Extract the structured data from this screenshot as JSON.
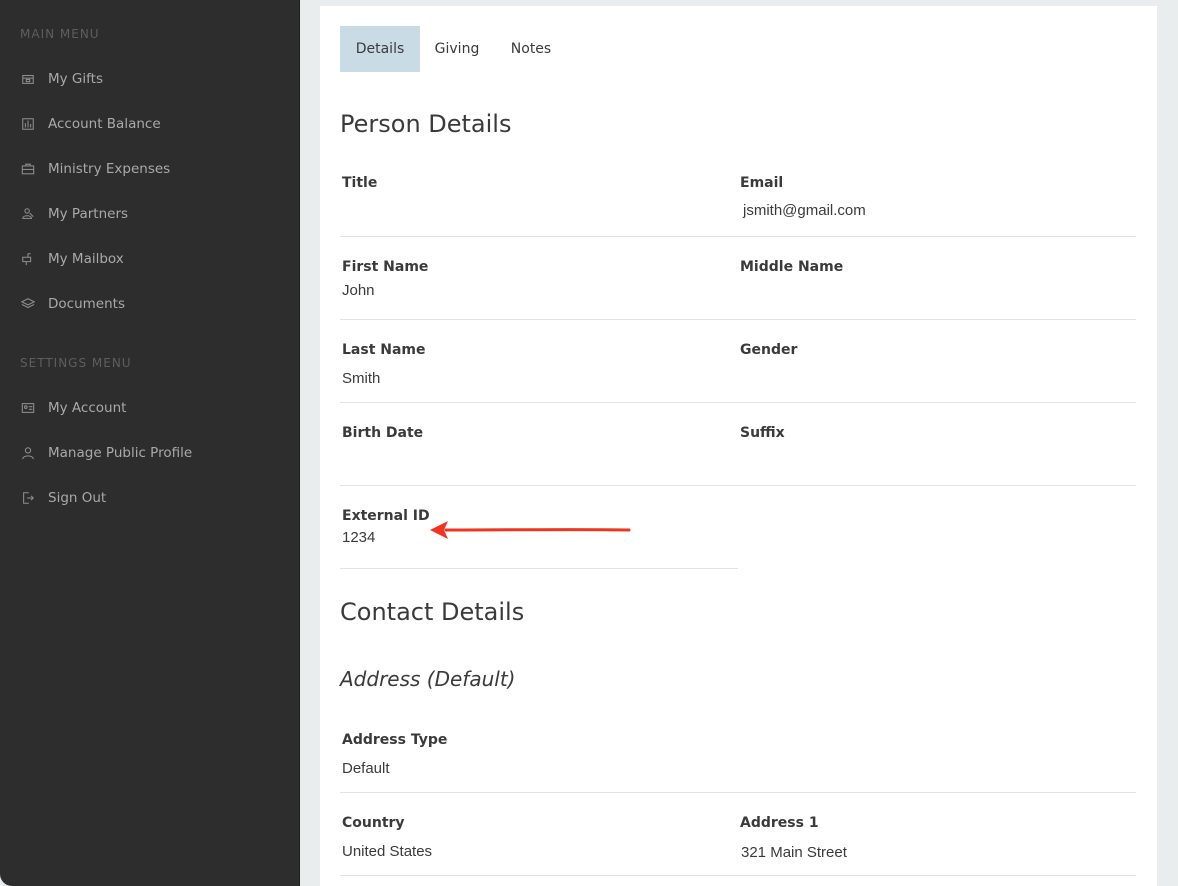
{
  "sidebar": {
    "main_menu_heading": "MAIN MENU",
    "main_items": [
      {
        "label": "My Gifts",
        "icon": "gift-icon"
      },
      {
        "label": "Account Balance",
        "icon": "bar-chart-icon"
      },
      {
        "label": "Ministry Expenses",
        "icon": "briefcase-icon"
      },
      {
        "label": "My Partners",
        "icon": "partners-icon"
      },
      {
        "label": "My Mailbox",
        "icon": "mailbox-icon"
      },
      {
        "label": "Documents",
        "icon": "layers-icon"
      }
    ],
    "settings_menu_heading": "SETTINGS MENU",
    "settings_items": [
      {
        "label": "My Account",
        "icon": "id-card-icon"
      },
      {
        "label": "Manage Public Profile",
        "icon": "user-icon"
      },
      {
        "label": "Sign Out",
        "icon": "sign-out-icon"
      }
    ]
  },
  "tabs": [
    {
      "label": "Details",
      "active": true
    },
    {
      "label": "Giving",
      "active": false
    },
    {
      "label": "Notes",
      "active": false
    }
  ],
  "person_details": {
    "title": "Person Details",
    "fields": {
      "title": {
        "label": "Title",
        "value": ""
      },
      "email": {
        "label": "Email",
        "value": "jsmith@gmail.com"
      },
      "first_name": {
        "label": "First Name",
        "value": "John"
      },
      "middle_name": {
        "label": "Middle Name",
        "value": ""
      },
      "last_name": {
        "label": "Last Name",
        "value": "Smith"
      },
      "gender": {
        "label": "Gender",
        "value": ""
      },
      "birth_date": {
        "label": "Birth Date",
        "value": ""
      },
      "suffix": {
        "label": "Suffix",
        "value": ""
      },
      "external_id": {
        "label": "External ID",
        "value": "1234"
      }
    }
  },
  "contact_details": {
    "title": "Contact Details",
    "address_heading": "Address (Default)",
    "fields": {
      "address_type": {
        "label": "Address Type",
        "value": "Default"
      },
      "country": {
        "label": "Country",
        "value": "United States"
      },
      "address1": {
        "label": "Address 1",
        "value": "321 Main Street"
      }
    }
  },
  "colors": {
    "sidebar_bg": "#2d2d2d",
    "active_tab_bg": "#c9dce6",
    "annotation_arrow": "#f0341f"
  }
}
